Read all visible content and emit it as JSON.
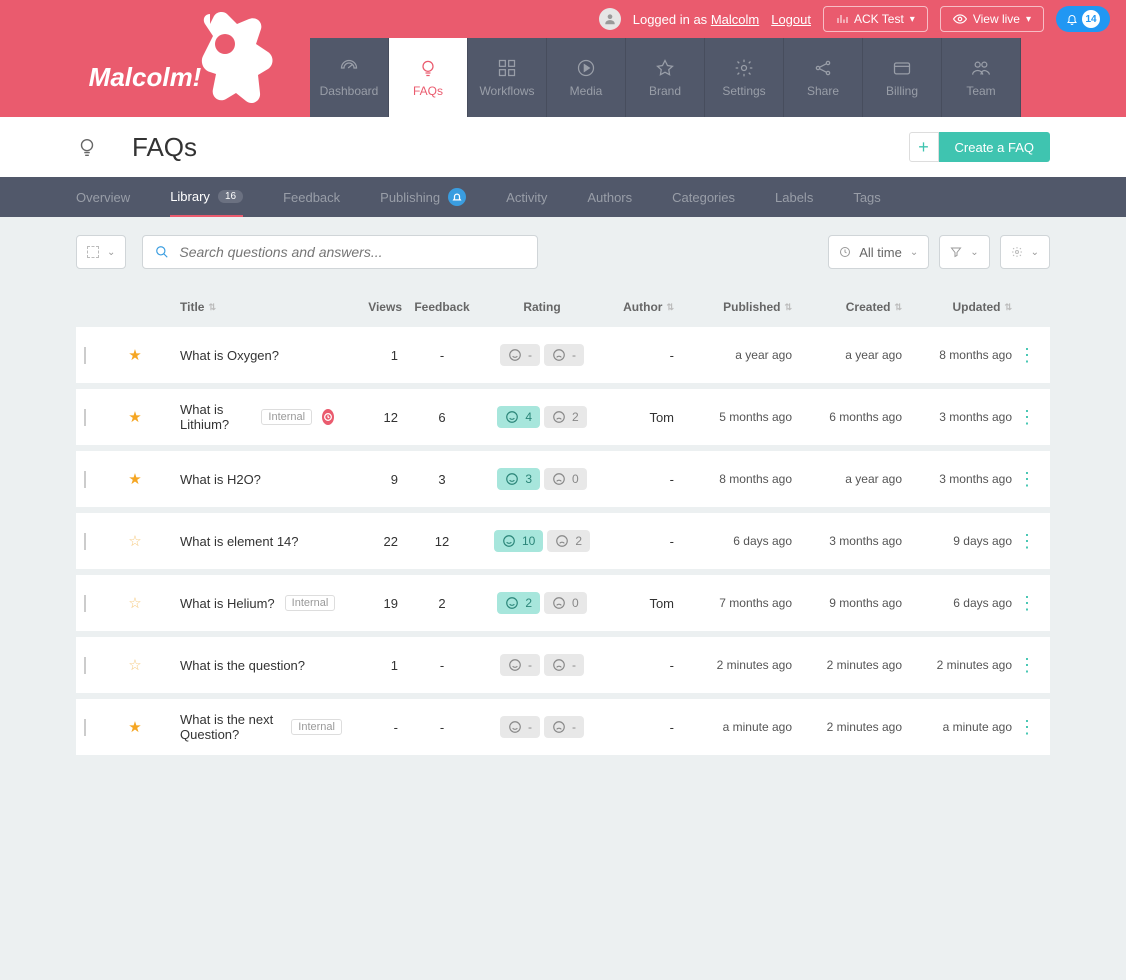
{
  "topbar": {
    "logged_in_prefix": "Logged in as ",
    "user": "Malcolm",
    "logout": "Logout",
    "ack_test": "ACK Test",
    "view_live": "View live",
    "notif_count": "14"
  },
  "brand": "Malcolm!",
  "nav": {
    "items": [
      {
        "id": "dashboard",
        "label": "Dashboard"
      },
      {
        "id": "faqs",
        "label": "FAQs"
      },
      {
        "id": "workflows",
        "label": "Workflows"
      },
      {
        "id": "media",
        "label": "Media"
      },
      {
        "id": "brand",
        "label": "Brand"
      },
      {
        "id": "settings",
        "label": "Settings"
      },
      {
        "id": "share",
        "label": "Share"
      },
      {
        "id": "billing",
        "label": "Billing"
      },
      {
        "id": "team",
        "label": "Team"
      }
    ]
  },
  "page": {
    "title": "FAQs",
    "create_label": "Create a FAQ"
  },
  "tabs": {
    "overview": "Overview",
    "library": "Library",
    "library_count": "16",
    "feedback": "Feedback",
    "publishing": "Publishing",
    "activity": "Activity",
    "authors": "Authors",
    "categories": "Categories",
    "labels": "Labels",
    "tags": "Tags"
  },
  "toolbar": {
    "search_placeholder": "Search questions and answers...",
    "all_time": "All time"
  },
  "columns": {
    "title": "Title",
    "views": "Views",
    "feedback": "Feedback",
    "rating": "Rating",
    "author": "Author",
    "published": "Published",
    "created": "Created",
    "updated": "Updated"
  },
  "labels": {
    "internal": "Internal"
  },
  "rows": [
    {
      "star": "filled",
      "title": "What is Oxygen?",
      "internal": false,
      "scheduled": false,
      "views": "1",
      "feedback": "-",
      "pos": "-",
      "pos_on": false,
      "neg": "-",
      "author": "-",
      "published": "a year ago",
      "created": "a year ago",
      "updated": "8 months ago"
    },
    {
      "star": "filled",
      "title": "What is Lithium?",
      "internal": true,
      "scheduled": true,
      "views": "12",
      "feedback": "6",
      "pos": "4",
      "pos_on": true,
      "neg": "2",
      "author": "Tom",
      "published": "5 months ago",
      "created": "6 months ago",
      "updated": "3 months ago"
    },
    {
      "star": "filled",
      "title": "What is H2O?",
      "internal": false,
      "scheduled": false,
      "views": "9",
      "feedback": "3",
      "pos": "3",
      "pos_on": true,
      "neg": "0",
      "author": "-",
      "published": "8 months ago",
      "created": "a year ago",
      "updated": "3 months ago"
    },
    {
      "star": "empty",
      "title": "What is element 14?",
      "internal": false,
      "scheduled": false,
      "views": "22",
      "feedback": "12",
      "pos": "10",
      "pos_on": true,
      "neg": "2",
      "author": "-",
      "published": "6 days ago",
      "created": "3 months ago",
      "updated": "9 days ago"
    },
    {
      "star": "empty",
      "title": "What is Helium?",
      "internal": true,
      "scheduled": false,
      "views": "19",
      "feedback": "2",
      "pos": "2",
      "pos_on": true,
      "neg": "0",
      "author": "Tom",
      "published": "7 months ago",
      "created": "9 months ago",
      "updated": "6 days ago"
    },
    {
      "star": "empty",
      "title": "What is the question?",
      "internal": false,
      "scheduled": false,
      "views": "1",
      "feedback": "-",
      "pos": "-",
      "pos_on": false,
      "neg": "-",
      "author": "-",
      "published": "2 minutes ago",
      "created": "2 minutes ago",
      "updated": "2 minutes ago"
    },
    {
      "star": "filled",
      "title": "What is the next Question?",
      "internal": true,
      "scheduled": false,
      "views": "-",
      "feedback": "-",
      "pos": "-",
      "pos_on": false,
      "neg": "-",
      "author": "-",
      "published": "a minute ago",
      "created": "2 minutes ago",
      "updated": "a minute ago"
    }
  ]
}
